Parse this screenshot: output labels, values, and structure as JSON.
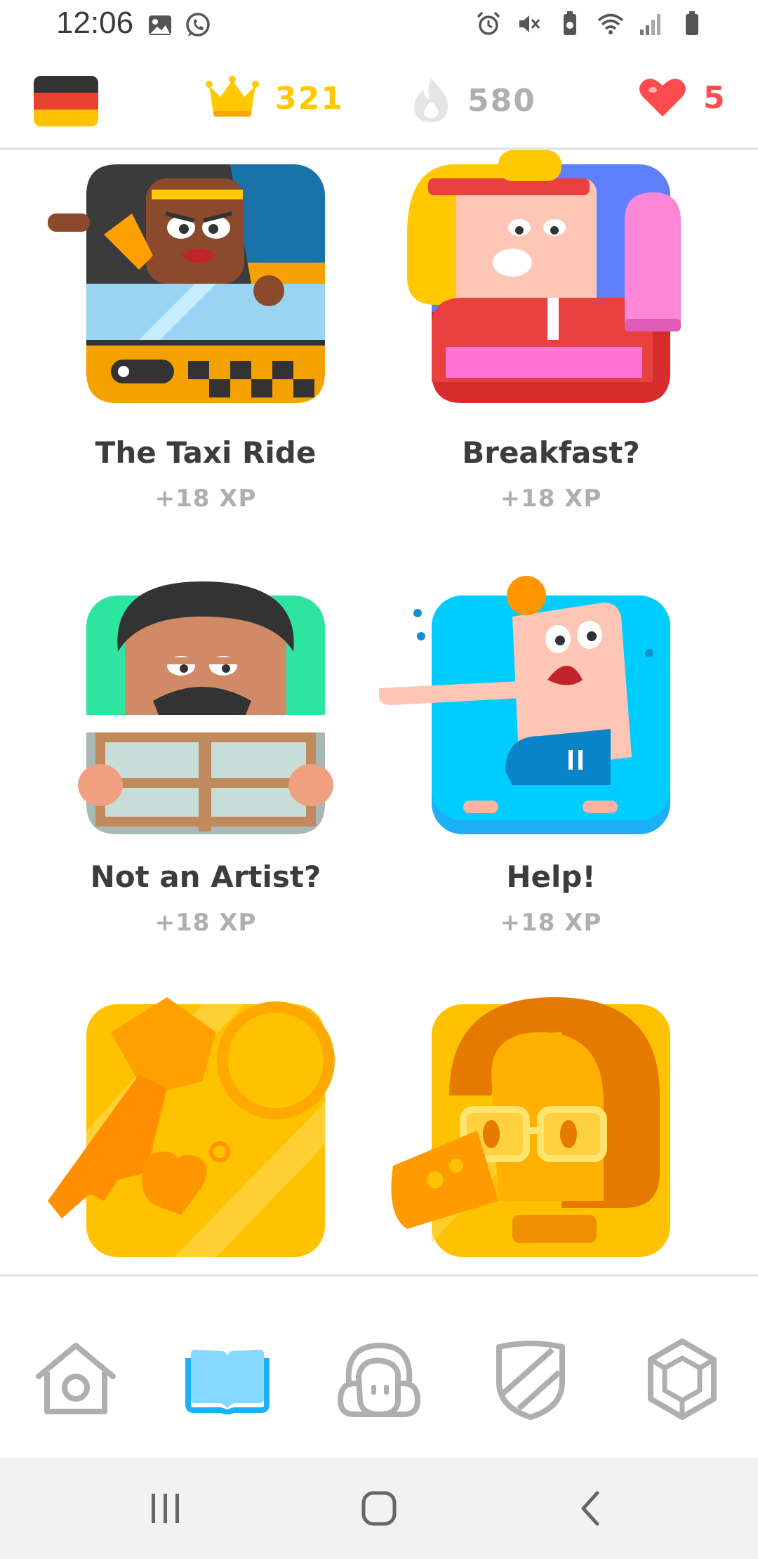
{
  "status_bar": {
    "time": "12:06",
    "left_icons": [
      "gallery-icon",
      "whatsapp-icon"
    ],
    "right_icons": [
      "alarm-icon",
      "mute-icon",
      "battery-saver-icon",
      "wifi-icon",
      "signal-icon",
      "battery-icon"
    ]
  },
  "top_bar": {
    "language_flag": "German flag",
    "flag_colors": [
      "#000000",
      "#dd0000",
      "#ffce00"
    ],
    "crowns": "321",
    "streak": "580",
    "hearts": "5",
    "colors": {
      "crown": "#ffc800",
      "streak": "#afafaf",
      "hearts": "#ff4b4b"
    }
  },
  "stories": [
    {
      "title": "The Taxi Ride",
      "xp": "+18 XP",
      "icon": "taxi-story-art"
    },
    {
      "title": "Breakfast?",
      "xp": "+18 XP",
      "icon": "breakfast-story-art"
    },
    {
      "title": "Not an Artist?",
      "xp": "+18 XP",
      "icon": "artist-story-art"
    },
    {
      "title": "Help!",
      "xp": "+18 XP",
      "icon": "help-story-art"
    },
    {
      "title": "",
      "xp": "",
      "icon": "key-story-art"
    },
    {
      "title": "",
      "xp": "",
      "icon": "glasses-woman-story-art"
    }
  ],
  "bottom_nav": {
    "items": [
      {
        "name": "home-icon",
        "active": false
      },
      {
        "name": "stories-book-icon",
        "active": true
      },
      {
        "name": "profile-icon",
        "active": false
      },
      {
        "name": "leagues-shield-icon",
        "active": false
      },
      {
        "name": "shop-gem-icon",
        "active": false
      }
    ],
    "active_color": "#1cb0f6"
  },
  "system_nav": [
    "recent-apps-icon",
    "home-button-icon",
    "back-icon"
  ]
}
